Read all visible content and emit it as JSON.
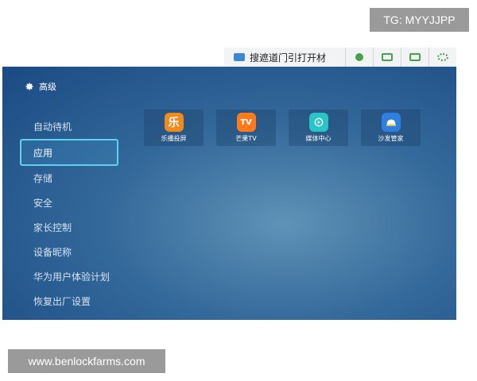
{
  "overlay": {
    "tg_badge": "TG: MYYJJPP",
    "watermark": "www.benlockfarms.com"
  },
  "browser_toolbar": {
    "search_text": "搜遮道门引打开材"
  },
  "header": {
    "title": "高级",
    "icon": "gear-icon"
  },
  "menu": {
    "items": [
      {
        "label": "自动待机",
        "selected": false
      },
      {
        "label": "应用",
        "selected": true
      },
      {
        "label": "存储",
        "selected": false
      },
      {
        "label": "安全",
        "selected": false
      },
      {
        "label": "家长控制",
        "selected": false
      },
      {
        "label": "设备昵称",
        "selected": false
      },
      {
        "label": "华为用户体验计划",
        "selected": false
      },
      {
        "label": "恢复出厂设置",
        "selected": false
      }
    ]
  },
  "apps": [
    {
      "label": "乐播投屏",
      "icon": "lebo-icon",
      "glyph": "乐",
      "color": "#f08a1c"
    },
    {
      "label": "芒果TV",
      "icon": "mango-tv-icon",
      "glyph": "TV",
      "color": "#ff7a1a"
    },
    {
      "label": "媒体中心",
      "icon": "media-center-icon",
      "glyph": "",
      "color": "#29c3c8"
    },
    {
      "label": "沙发管家",
      "icon": "sofa-butler-icon",
      "glyph": "",
      "color": "#2f7fe0"
    }
  ]
}
